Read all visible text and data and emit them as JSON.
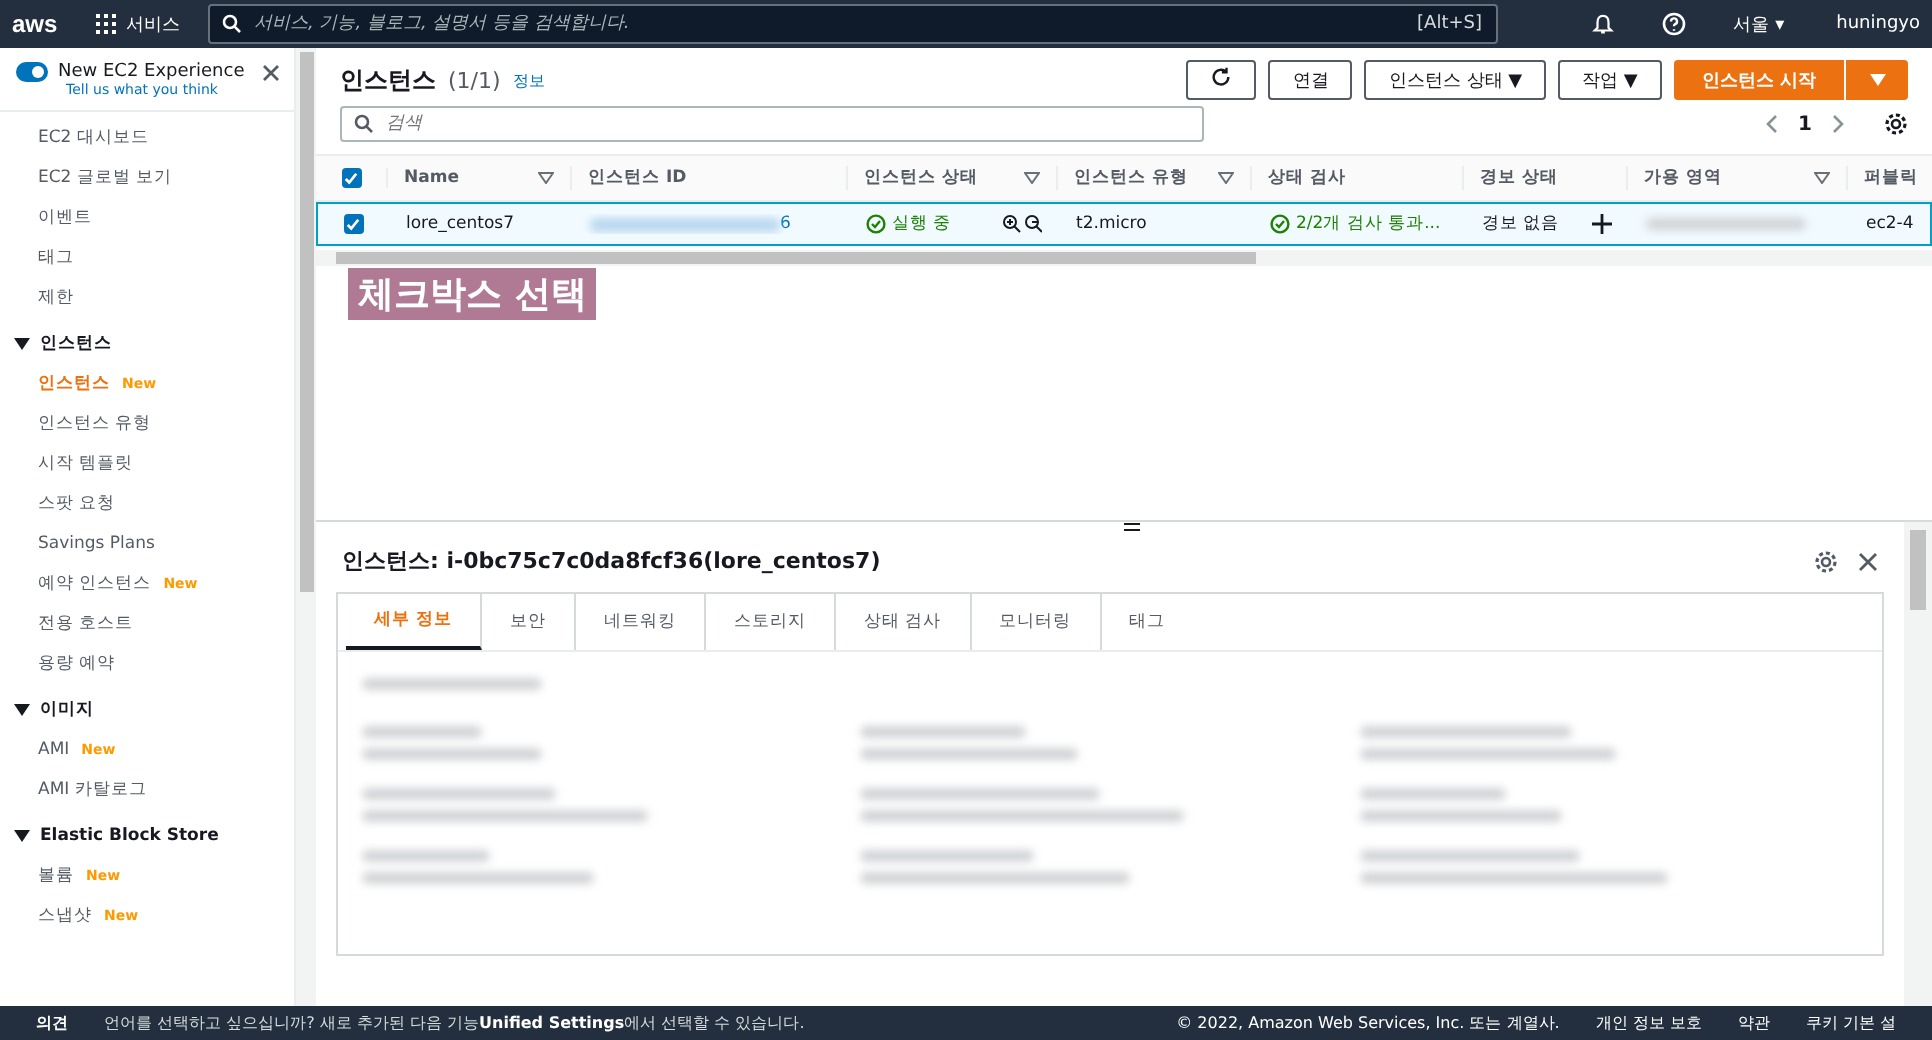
{
  "topnav": {
    "logo": "aws",
    "services": "서비스",
    "search_placeholder": "서비스, 기능, 블로그, 설명서 등을 검색합니다.",
    "shortcut": "[Alt+S]",
    "region": "서울 ▾",
    "user": "huningyo"
  },
  "sidebar": {
    "experience": {
      "label": "New EC2 Experience",
      "on": true,
      "link": "Tell us what you think"
    },
    "groups": [
      {
        "items": [
          {
            "label": "EC2 대시보드",
            "selected": false
          },
          {
            "label": "EC2 글로벌 보기",
            "selected": false
          },
          {
            "label": "이벤트",
            "selected": false
          },
          {
            "label": "태그",
            "selected": false
          },
          {
            "label": "제한",
            "selected": false
          }
        ]
      },
      {
        "title": "인스턴스",
        "expanded": true,
        "items": [
          {
            "label": "인스턴스",
            "badge": "New",
            "selected": true
          },
          {
            "label": "인스턴스 유형",
            "selected": false
          },
          {
            "label": "시작 템플릿",
            "selected": false
          },
          {
            "label": "스팟 요청",
            "selected": false
          },
          {
            "label": "Savings Plans",
            "selected": false
          },
          {
            "label": "예약 인스턴스",
            "badge": "New",
            "selected": false
          },
          {
            "label": "전용 호스트",
            "selected": false
          },
          {
            "label": "용량 예약",
            "selected": false
          }
        ]
      },
      {
        "title": "이미지",
        "expanded": true,
        "items": [
          {
            "label": "AMI",
            "badge": "New",
            "selected": false
          },
          {
            "label": "AMI 카탈로그",
            "selected": false
          }
        ]
      },
      {
        "title": "Elastic Block Store",
        "expanded": true,
        "items": [
          {
            "label": "볼륨",
            "badge": "New",
            "selected": false
          },
          {
            "label": "스냅샷",
            "badge": "New",
            "selected": false
          }
        ]
      }
    ]
  },
  "header": {
    "title": "인스턴스",
    "count": "(1/1)",
    "info": "정보",
    "buttons": [
      "연결",
      "인스턴스 상태 ▼",
      "작업 ▼"
    ],
    "primary": "인스턴스 시작",
    "search_placeholder": "검색",
    "page": "1"
  },
  "table": {
    "all_checked": true,
    "columns": [
      "Name",
      "인스턴스 ID",
      "인스턴스 상태",
      "인스턴스 유형",
      "상태 검사",
      "경보 상태",
      "가용 영역",
      "퍼블릭"
    ],
    "rows": [
      {
        "checked": true,
        "selected": true,
        "name": "lore_centos7",
        "id_tail": "6",
        "state": "실행 중",
        "type": "t2.micro",
        "check": "2/2개 검사 통과...",
        "alarm": "경보 없음",
        "public": "ec2-4"
      }
    ]
  },
  "annotation": "체크박스 선택",
  "detail": {
    "title": "인스턴스: i-0bc75c7c0da8fcf36(lore_centos7)",
    "tabs": [
      {
        "label": "세부 정보",
        "selected": true
      },
      {
        "label": "보안",
        "selected": false
      },
      {
        "label": "네트워킹",
        "selected": false
      },
      {
        "label": "스토리지",
        "selected": false
      },
      {
        "label": "상태 검사",
        "selected": false
      },
      {
        "label": "모니터링",
        "selected": false
      },
      {
        "label": "태그",
        "selected": false
      }
    ]
  },
  "footer": {
    "feedback": "의견",
    "message_before": "언어를 선택하고 싶으십니까? 새로 추가된 다음 기능",
    "settings_link": "Unified Settings",
    "message_after": "에서 선택할 수 있습니다.",
    "copyright": "© 2022, Amazon Web Services, Inc. 또는 계열사.",
    "links": [
      "개인 정보 보호",
      "약관",
      "쿠키 기본 설"
    ]
  }
}
